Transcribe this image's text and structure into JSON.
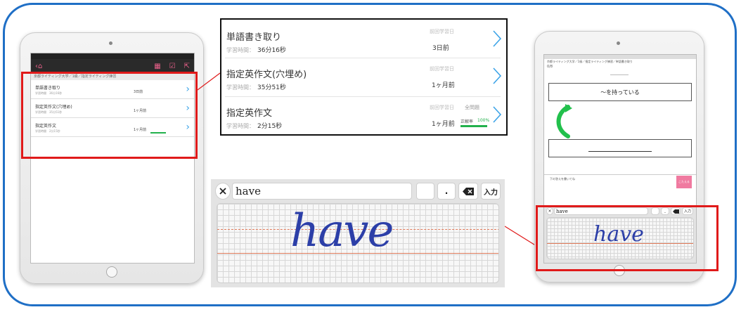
{
  "left_ipad": {
    "nav": {
      "back_icon": "chevron-left-icon",
      "home_icon": "home-icon"
    },
    "breadcrumb": "京都ライティング大学／1級／指定ライティング練習",
    "rows": [
      {
        "title": "単語書き取り",
        "sub": "学習時間　36分16秒",
        "time": "3日前"
      },
      {
        "title": "指定英作文(穴埋め)",
        "sub": "学習時間　35分51秒",
        "time": "1ヶ月前"
      },
      {
        "title": "指定英作文",
        "sub": "学習時間　2分15秒",
        "time": "1ヶ月前"
      }
    ]
  },
  "popup": {
    "rows": [
      {
        "title": "単語書き取り",
        "time_label": "学習時間：",
        "time_value": "36分16秒",
        "last_label": "前回学習日",
        "last_value": "3日前",
        "extra_label": "",
        "progress_label": "",
        "progress_value": ""
      },
      {
        "title": "指定英作文(穴埋め)",
        "time_label": "学習時間：",
        "time_value": "35分51秒",
        "last_label": "前回学習日",
        "last_value": "1ヶ月前",
        "extra_label": "",
        "progress_label": "",
        "progress_value": ""
      },
      {
        "title": "指定英作文",
        "time_label": "学習時間：",
        "time_value": "2分15秒",
        "last_label": "前回学習日",
        "last_value": "1ヶ月前",
        "extra_label": "全問題",
        "progress_label": "正解率",
        "progress_value": "100%"
      }
    ]
  },
  "pad": {
    "input_value": "have",
    "handwriting": "have",
    "period_key": ".",
    "enter_key": "入力",
    "clear_icon": "close-icon",
    "backspace_icon": "backspace-icon"
  },
  "right_ipad": {
    "breadcrumb": "京都ライティング大学／1級／指定ライティング練習／単語書き取り",
    "counter": "0/8",
    "prompt": "～を持っている",
    "small_label": "下の答えを書いてね",
    "submit_label": "こたえる",
    "input_value": "have",
    "handwriting": "have",
    "period_key": ".",
    "enter_key": "入力"
  },
  "colors": {
    "frame": "#1f6fc6",
    "highlight": "#e01a1a",
    "accent_blue": "#3da4e8",
    "progress": "#22b14c",
    "ink": "#2c3fa8"
  }
}
